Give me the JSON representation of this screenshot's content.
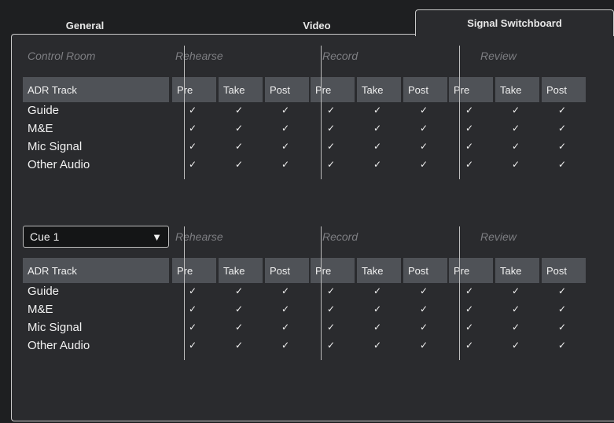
{
  "tabs": [
    {
      "label": "General"
    },
    {
      "label": "Video"
    },
    {
      "label": "Signal Switchboard"
    }
  ],
  "groups": [
    "Rehearse",
    "Record",
    "Review"
  ],
  "columns": [
    "Pre",
    "Take",
    "Post",
    "Pre",
    "Take",
    "Post",
    "Pre",
    "Take",
    "Post"
  ],
  "section1": {
    "label": "Control Room",
    "track_header": "ADR Track",
    "rows": [
      "Guide",
      "M&E",
      "Mic Signal",
      "Other Audio"
    ],
    "check_glyph": "✓"
  },
  "section2": {
    "cue_value": "Cue 1",
    "cue_arrow": "▼",
    "track_header": "ADR Track",
    "rows": [
      "Guide",
      "M&E",
      "Mic Signal",
      "Other Audio"
    ],
    "check_glyph": "✓"
  }
}
